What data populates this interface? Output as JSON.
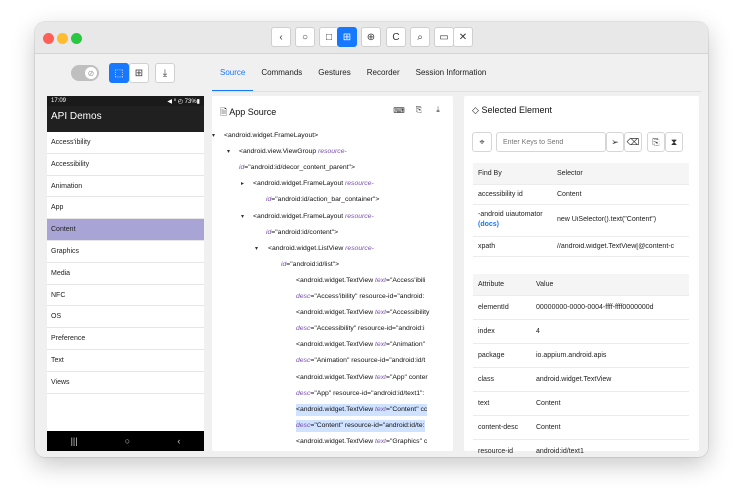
{
  "titlebar": {
    "nav_buttons": [
      "‹",
      "○",
      "□"
    ],
    "mode_buttons": [
      "⊞",
      "⊕"
    ],
    "tool_buttons": [
      "C",
      "⌕",
      "▭"
    ],
    "close_button": "✕"
  },
  "toolbar": {
    "toggle_icon": "⊘",
    "select_icon": "⬚",
    "tap_icon": "⊞",
    "download_icon": "⤓",
    "tabs": [
      {
        "label": "Source",
        "active": true
      },
      {
        "label": "Commands",
        "active": false
      },
      {
        "label": "Gestures",
        "active": false
      },
      {
        "label": "Recorder",
        "active": false
      },
      {
        "label": "Session Information",
        "active": false
      }
    ]
  },
  "device": {
    "status_time": "17:09",
    "status_icons": "◀︎ ⁰ ◴ 73%▮",
    "app_title": "API Demos",
    "items": [
      {
        "label": "Access'ibility",
        "selected": false
      },
      {
        "label": "Accessibility",
        "selected": false
      },
      {
        "label": "Animation",
        "selected": false
      },
      {
        "label": "App",
        "selected": false
      },
      {
        "label": "Content",
        "selected": true
      },
      {
        "label": "Graphics",
        "selected": false
      },
      {
        "label": "Media",
        "selected": false
      },
      {
        "label": "NFC",
        "selected": false
      },
      {
        "label": "OS",
        "selected": false
      },
      {
        "label": "Preference",
        "selected": false
      },
      {
        "label": "Text",
        "selected": false
      },
      {
        "label": "Views",
        "selected": false
      }
    ],
    "nav": [
      "|||",
      "○",
      "‹"
    ]
  },
  "source_panel": {
    "title": "App Source",
    "title_icon": "🗎",
    "tools": [
      "⌨",
      "⎘",
      "⤓"
    ],
    "lines": [
      {
        "caret": "▾",
        "tag": "<android.widget.FrameLayout>",
        "attr": "",
        "val": "",
        "hl": false
      },
      {
        "caret": "▾",
        "tag": "<android.view.ViewGroup",
        "attr": " resource-",
        "val": "",
        "hl": false
      },
      {
        "caret": "",
        "tag": "",
        "attr": "id",
        "val": "=\"android:id/decor_content_parent\">",
        "hl": false
      },
      {
        "caret": "▸",
        "tag": "<android.widget.FrameLayout",
        "attr": " resource-",
        "val": "",
        "hl": false
      },
      {
        "caret": "",
        "tag": "",
        "attr": "id",
        "val": "=\"android:id/action_bar_container\">",
        "hl": false
      },
      {
        "caret": "▾",
        "tag": "<android.widget.FrameLayout",
        "attr": " resource-",
        "val": "",
        "hl": false
      },
      {
        "caret": "",
        "tag": "",
        "attr": "id",
        "val": "=\"android:id/content\">",
        "hl": false
      },
      {
        "caret": "▾",
        "tag": "<android.widget.ListView",
        "attr": " resource-",
        "val": "",
        "hl": false
      },
      {
        "caret": "",
        "tag": "",
        "attr": "id",
        "val": "=\"android:id/list\">",
        "hl": false
      },
      {
        "caret": "",
        "tag": "<android.widget.TextView",
        "attr": " text",
        "val": "=\"Access'ibili",
        "hl": false
      },
      {
        "caret": "",
        "tag": "",
        "attr": "desc",
        "val": "=\"Access'ibility\" resource-id=\"android:",
        "hl": false
      },
      {
        "caret": "",
        "tag": "<android.widget.TextView",
        "attr": " text",
        "val": "=\"Accessibility",
        "hl": false
      },
      {
        "caret": "",
        "tag": "",
        "attr": "desc",
        "val": "=\"Accessibility\" resource-id=\"android:i",
        "hl": false
      },
      {
        "caret": "",
        "tag": "<android.widget.TextView",
        "attr": " text",
        "val": "=\"Animation\"",
        "hl": false
      },
      {
        "caret": "",
        "tag": "",
        "attr": "desc",
        "val": "=\"Animation\" resource-id=\"android:id/t",
        "hl": false
      },
      {
        "caret": "",
        "tag": "<android.widget.TextView",
        "attr": " text",
        "val": "=\"App\" conter",
        "hl": false
      },
      {
        "caret": "",
        "tag": "",
        "attr": "desc",
        "val": "=\"App\" resource-id=\"android:id/text1\":",
        "hl": false
      },
      {
        "caret": "",
        "tag": "<android.widget.TextView",
        "attr": " text",
        "val": "=\"Content\" cc",
        "hl": true
      },
      {
        "caret": "",
        "tag": "",
        "attr": "desc",
        "val": "=\"Content\" resource-id=\"android:id/te:",
        "hl": true
      },
      {
        "caret": "",
        "tag": "<android.widget.TextView",
        "attr": " text",
        "val": "=\"Graphics\" c",
        "hl": false
      }
    ]
  },
  "selected_panel": {
    "title": "Selected Element",
    "title_icon": "◇",
    "target_icon": "⌖",
    "keys_placeholder": "Enter Keys to Send",
    "send_icon": "➢",
    "clear_icon": "⌫",
    "copy_icon": "⎘",
    "hourglass_icon": "⧗",
    "find_headers": [
      "Find By",
      "Selector"
    ],
    "find_rows": [
      {
        "by": "accessibility id",
        "sel": "Content",
        "docs": ""
      },
      {
        "by": "-android uiautomator",
        "sel": "new UiSelector().text(\"Content\")",
        "docs": "(docs)"
      },
      {
        "by": "xpath",
        "sel": "//android.widget.TextView[@content-c",
        "docs": ""
      }
    ],
    "attr_headers": [
      "Attribute",
      "Value"
    ],
    "attr_rows": [
      {
        "name": "elementId",
        "value": "00000000-0000-0004-ffff-ffff0000000d"
      },
      {
        "name": "index",
        "value": "4"
      },
      {
        "name": "package",
        "value": "io.appium.android.apis"
      },
      {
        "name": "class",
        "value": "android.widget.TextView"
      },
      {
        "name": "text",
        "value": "Content"
      },
      {
        "name": "content-desc",
        "value": "Content"
      },
      {
        "name": "resource-id",
        "value": "android:id/text1"
      }
    ]
  }
}
